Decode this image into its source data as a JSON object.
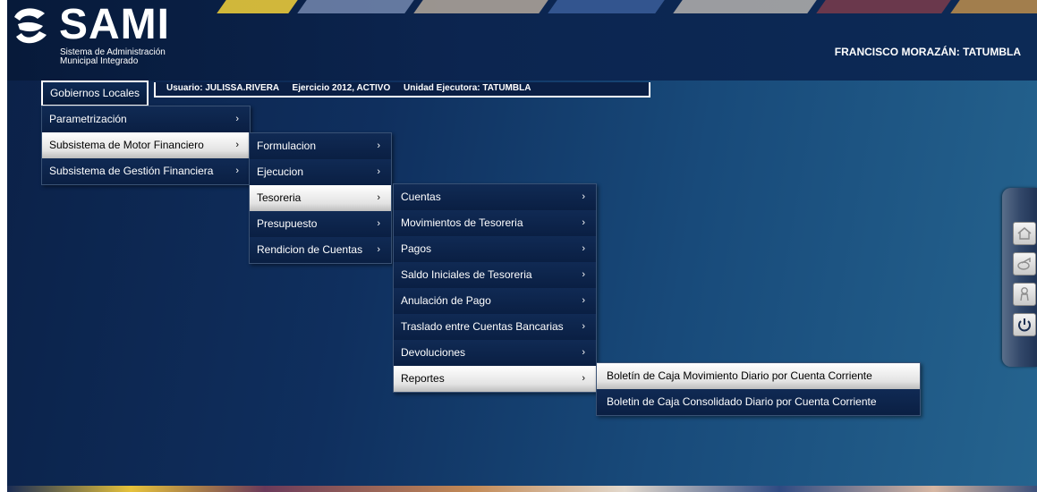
{
  "header": {
    "logo_title": "SAMI",
    "logo_subtitle_line1": "Sistema de Administración",
    "logo_subtitle_line2": "Municipal Integrado",
    "region": "FRANCISCO MORAZÁN: TATUMBLA"
  },
  "top_menu": {
    "label": "Gobiernos Locales"
  },
  "info_bar": {
    "user": "Usuario: JULISSA.RIVERA",
    "exercise": "Ejercicio 2012, ACTIVO",
    "unit": "Unidad Ejecutora: TATUMBLA"
  },
  "menu_level1": {
    "items": [
      {
        "label": "Parametrización",
        "arrow": "›"
      },
      {
        "label": "Subsistema de Motor Financiero",
        "arrow": "›"
      },
      {
        "label": "Subsistema de Gestión Financiera",
        "arrow": "›"
      }
    ]
  },
  "menu_level2": {
    "items": [
      {
        "label": "Formulacion",
        "arrow": "›"
      },
      {
        "label": "Ejecucion",
        "arrow": "›"
      },
      {
        "label": "Tesoreria",
        "arrow": "›"
      },
      {
        "label": "Presupuesto",
        "arrow": "›"
      },
      {
        "label": "Rendicion de Cuentas",
        "arrow": "›"
      }
    ]
  },
  "menu_level3": {
    "items": [
      {
        "label": "Cuentas",
        "arrow": "›"
      },
      {
        "label": "Movimientos de Tesoreria",
        "arrow": "›"
      },
      {
        "label": "Pagos",
        "arrow": "›"
      },
      {
        "label": "Saldo Iniciales de Tesoreria",
        "arrow": "›"
      },
      {
        "label": "Anulación de Pago",
        "arrow": "›"
      },
      {
        "label": "Traslado entre Cuentas Bancarias",
        "arrow": "›"
      },
      {
        "label": "Devoluciones",
        "arrow": "›"
      },
      {
        "label": "Reportes",
        "arrow": "›"
      }
    ]
  },
  "menu_level4": {
    "items": [
      {
        "label": "Boletín de Caja Movimiento Diario por Cuenta Corriente"
      },
      {
        "label": "Boletin de Caja Consolidado Diario por Cuenta Corriente"
      }
    ]
  },
  "side_panel": {
    "buttons": [
      "home-icon",
      "mail-icon",
      "user-icon",
      "power-icon"
    ]
  },
  "colors": {
    "background": "#0f2f5e",
    "menu_item": "#0a1f43",
    "active_item": "#ffffff",
    "text": "#ffffff"
  }
}
